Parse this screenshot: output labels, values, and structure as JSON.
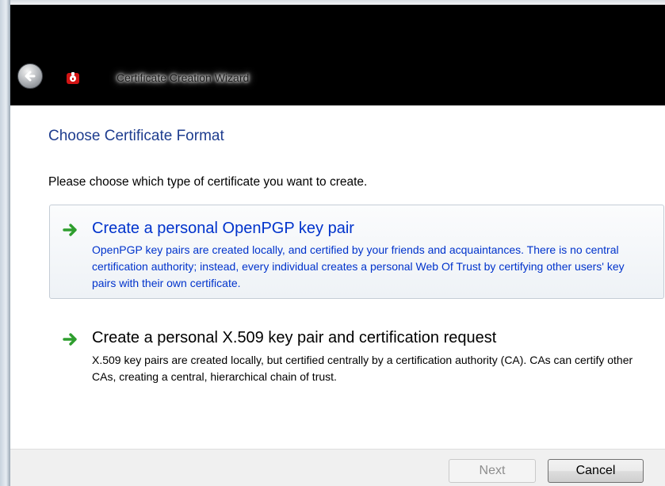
{
  "window": {
    "title": "Certificate Creation Wizard"
  },
  "page": {
    "title": "Choose Certificate Format",
    "instruction": "Please choose which type of certificate you want to create."
  },
  "options": [
    {
      "title": "Create a personal OpenPGP key pair",
      "description": "OpenPGP key pairs are created locally, and certified by your friends and acquaintances. There is no central certification authority; instead, every individual creates a personal Web Of Trust by certifying other users' key pairs with their own certificate.",
      "icon": "green-arrow-icon",
      "state": "hovered"
    },
    {
      "title": "Create a personal X.509 key pair and certification request",
      "description": "X.509 key pairs are created locally, but certified centrally by a certification authority (CA). CAs can certify other CAs, creating a central, hierarchical chain of trust.",
      "icon": "green-arrow-icon",
      "state": "normal"
    }
  ],
  "footer": {
    "next_label": "Next",
    "cancel_label": "Cancel"
  },
  "colors": {
    "title_blue": "#1e3d8f",
    "link_blue": "#0033cc",
    "arrow_green": "#2e9e2e",
    "title_band": "#000000"
  },
  "icons": {
    "back": "back-arrow-icon",
    "app": "certificate-app-icon"
  }
}
